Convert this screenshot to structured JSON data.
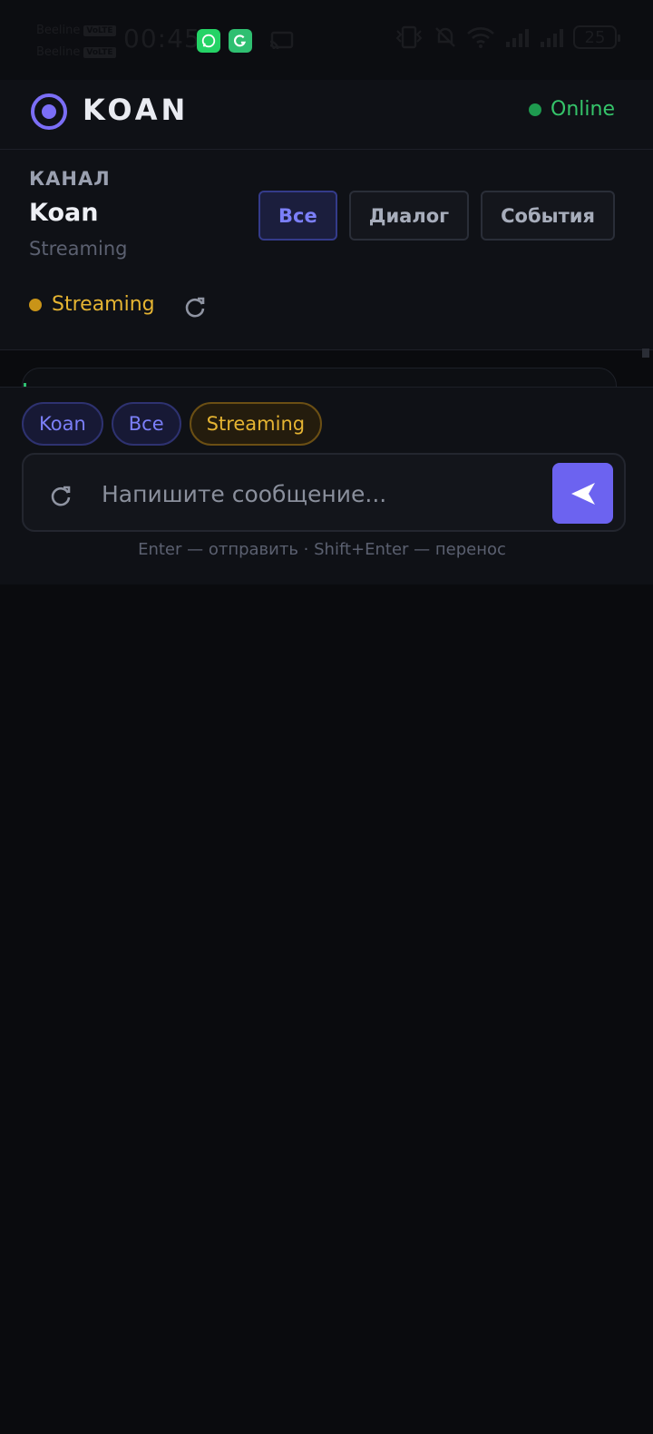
{
  "status_bar": {
    "carrier_1": "Beeline",
    "carrier_1_tag": "VoLTE",
    "carrier_2": "Beeline",
    "carrier_2_tag": "VoLTE",
    "time": "00:45",
    "battery": "25",
    "icons": [
      "whatsapp-icon",
      "grammarly-icon",
      "cast-icon",
      "vibrate-icon",
      "mute-icon",
      "wifi-icon",
      "signal-icon",
      "signal-icon",
      "battery-icon"
    ]
  },
  "header": {
    "brand": "KOAN",
    "status": "Online"
  },
  "channel": {
    "kicker": "КАНАЛ",
    "title": "Koan",
    "subtitle": "Streaming",
    "filters": [
      {
        "label": "Все",
        "active": true
      },
      {
        "label": "Диалог",
        "active": false
      },
      {
        "label": "События",
        "active": false
      }
    ],
    "stream_status": "Streaming"
  },
  "composer": {
    "chips": [
      {
        "label": "Koan"
      },
      {
        "label": "Все"
      },
      {
        "label": "Streaming"
      }
    ],
    "placeholder": "Напишите сообщение...",
    "hint": "Enter — отправить · Shift+Enter — перенос"
  },
  "colors": {
    "accent": "#6c63f0",
    "online": "#35c46a",
    "streaming": "#e5b432",
    "background": "#0a0b0e"
  }
}
